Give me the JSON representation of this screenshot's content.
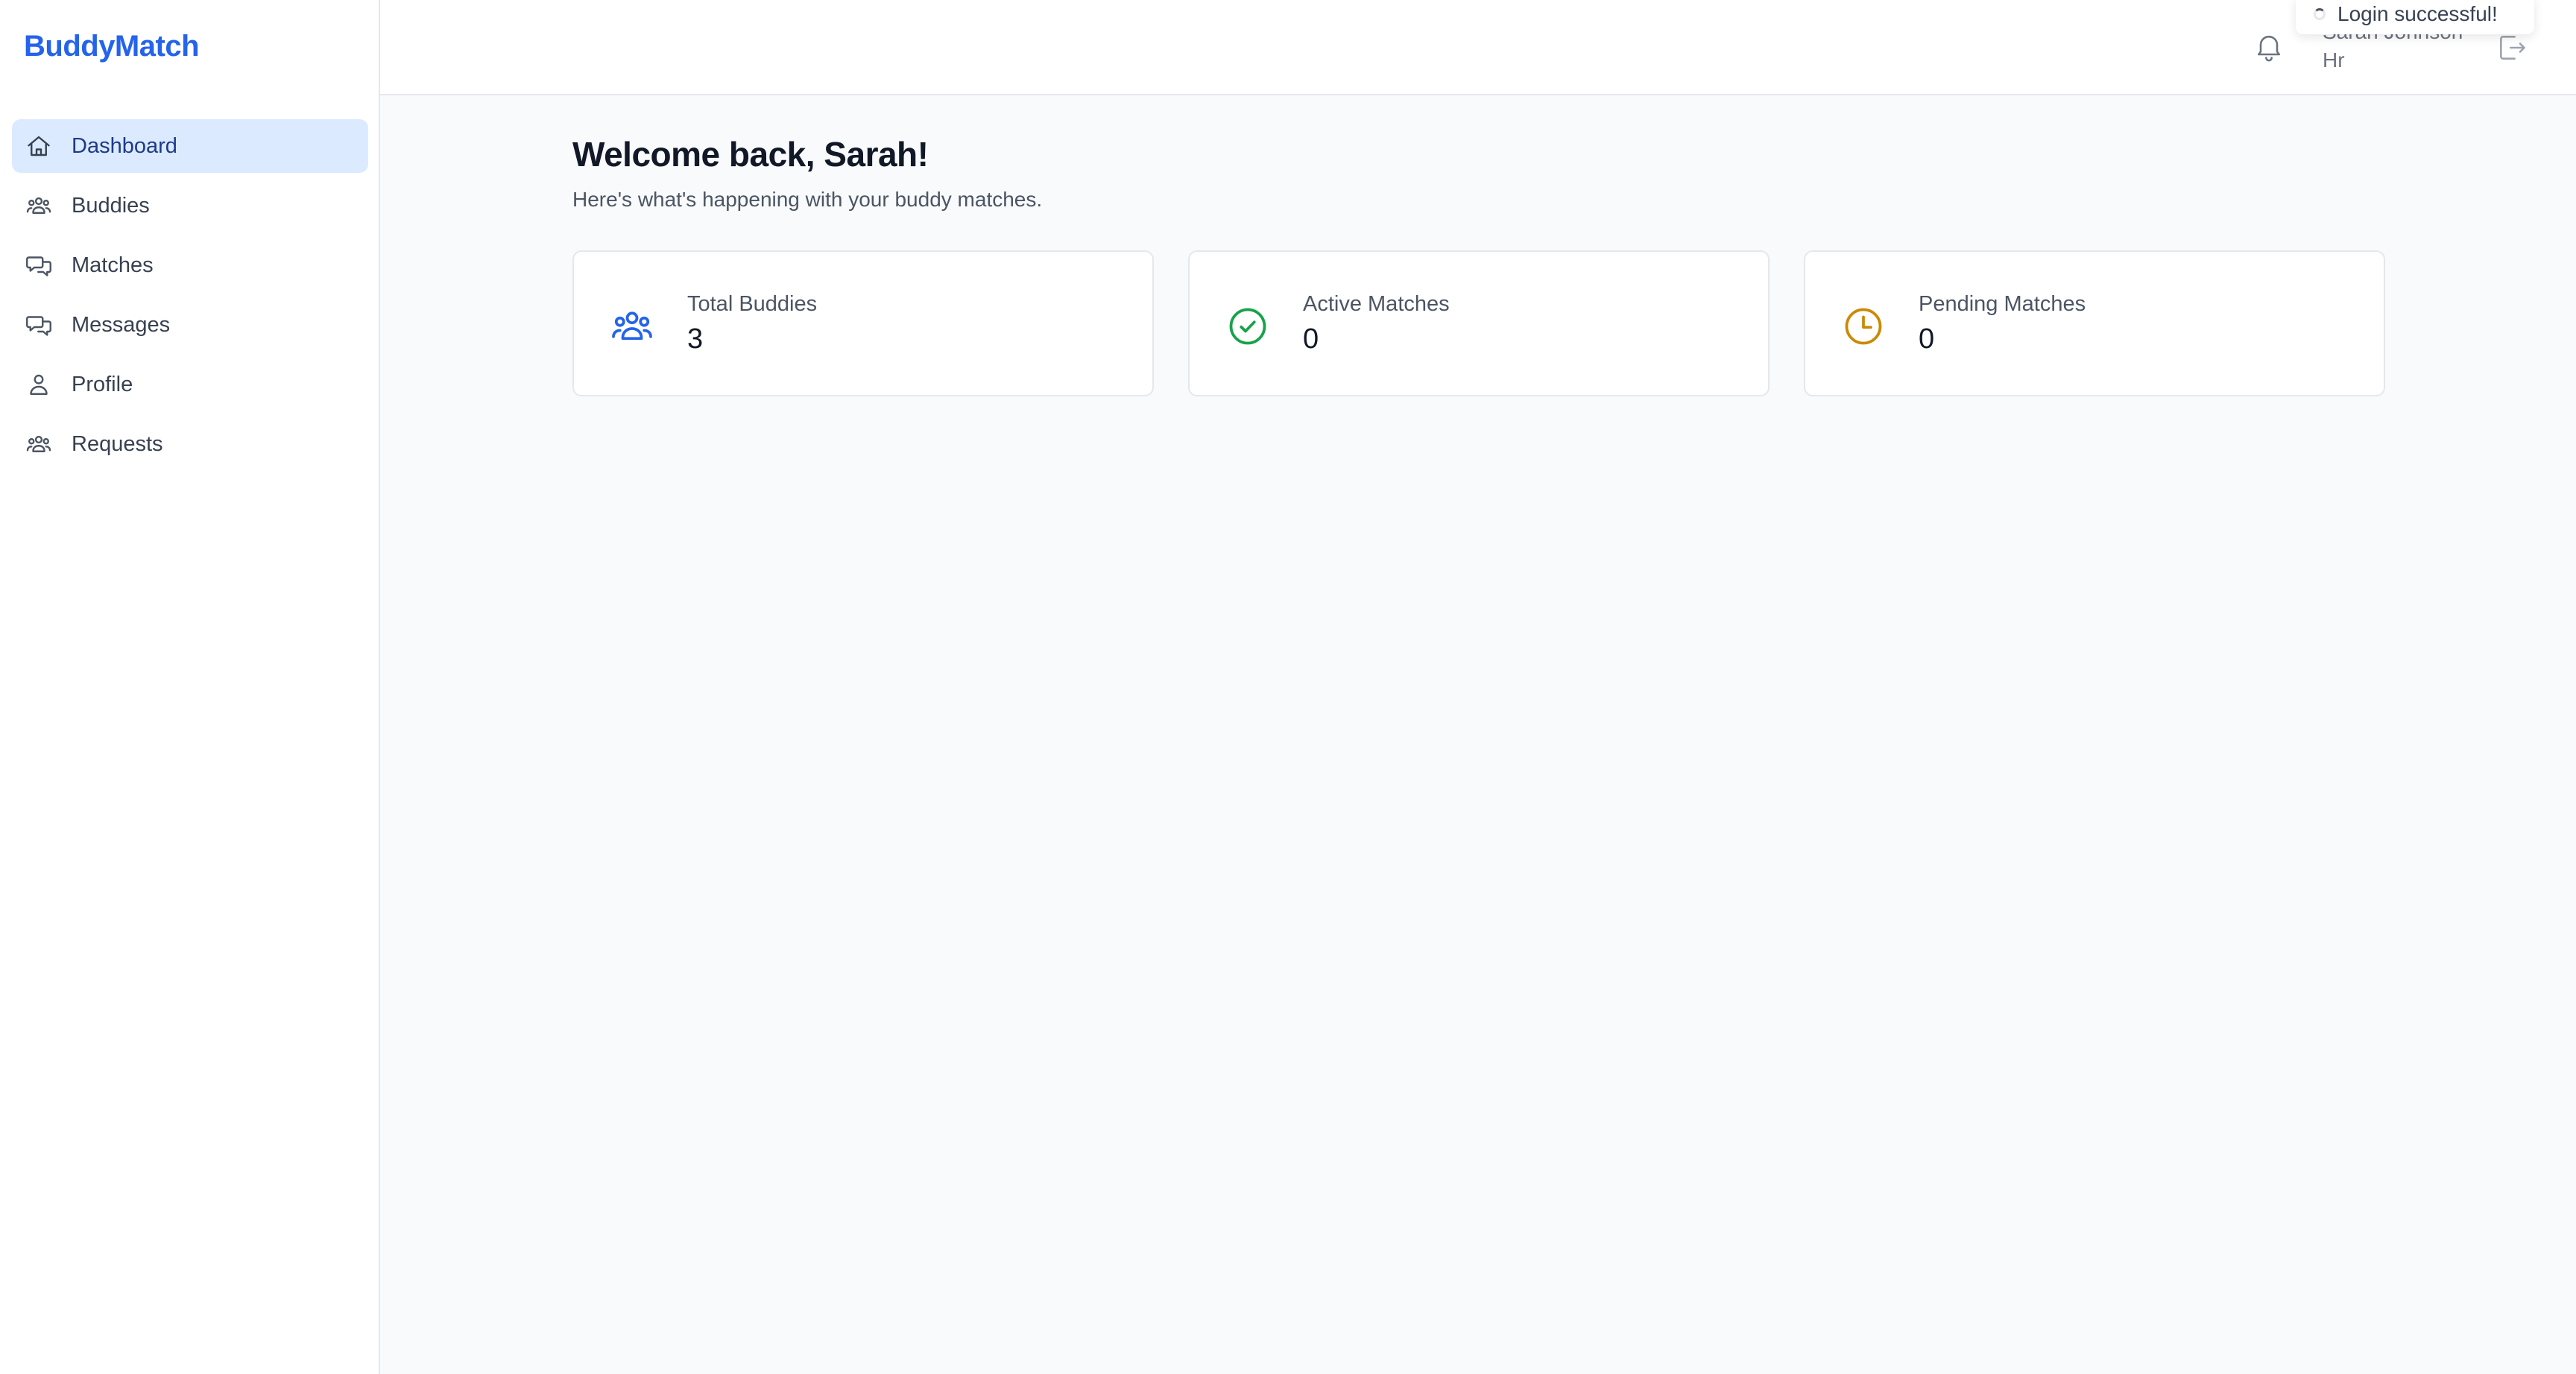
{
  "app": {
    "brand": "BuddyMatch"
  },
  "sidebar": {
    "items": [
      {
        "label": "Dashboard",
        "icon": "home-icon",
        "active": true
      },
      {
        "label": "Buddies",
        "icon": "users-icon",
        "active": false
      },
      {
        "label": "Matches",
        "icon": "chat-bubbles-icon",
        "active": false
      },
      {
        "label": "Messages",
        "icon": "chat-bubbles-icon",
        "active": false
      },
      {
        "label": "Profile",
        "icon": "user-icon",
        "active": false
      },
      {
        "label": "Requests",
        "icon": "users-icon",
        "active": false
      }
    ]
  },
  "header": {
    "user_name": "Sarah Johnson",
    "user_role": "Hr",
    "toast": "Login successful!",
    "icons": {
      "notification": "bell-icon",
      "logout": "logout-icon"
    }
  },
  "main": {
    "welcome": "Welcome back, Sarah!",
    "subtitle": "Here's what's happening with your buddy matches.",
    "stats": [
      {
        "label": "Total Buddies",
        "value": "3",
        "icon": "users-icon",
        "color": "#2563eb"
      },
      {
        "label": "Active Matches",
        "value": "0",
        "icon": "check-circle-icon",
        "color": "#16a34a"
      },
      {
        "label": "Pending Matches",
        "value": "0",
        "icon": "clock-icon",
        "color": "#ca8a04"
      }
    ]
  },
  "colors": {
    "accent": "#2563eb",
    "active_nav_bg": "#dbeafe",
    "page_bg": "#f8fafc"
  }
}
